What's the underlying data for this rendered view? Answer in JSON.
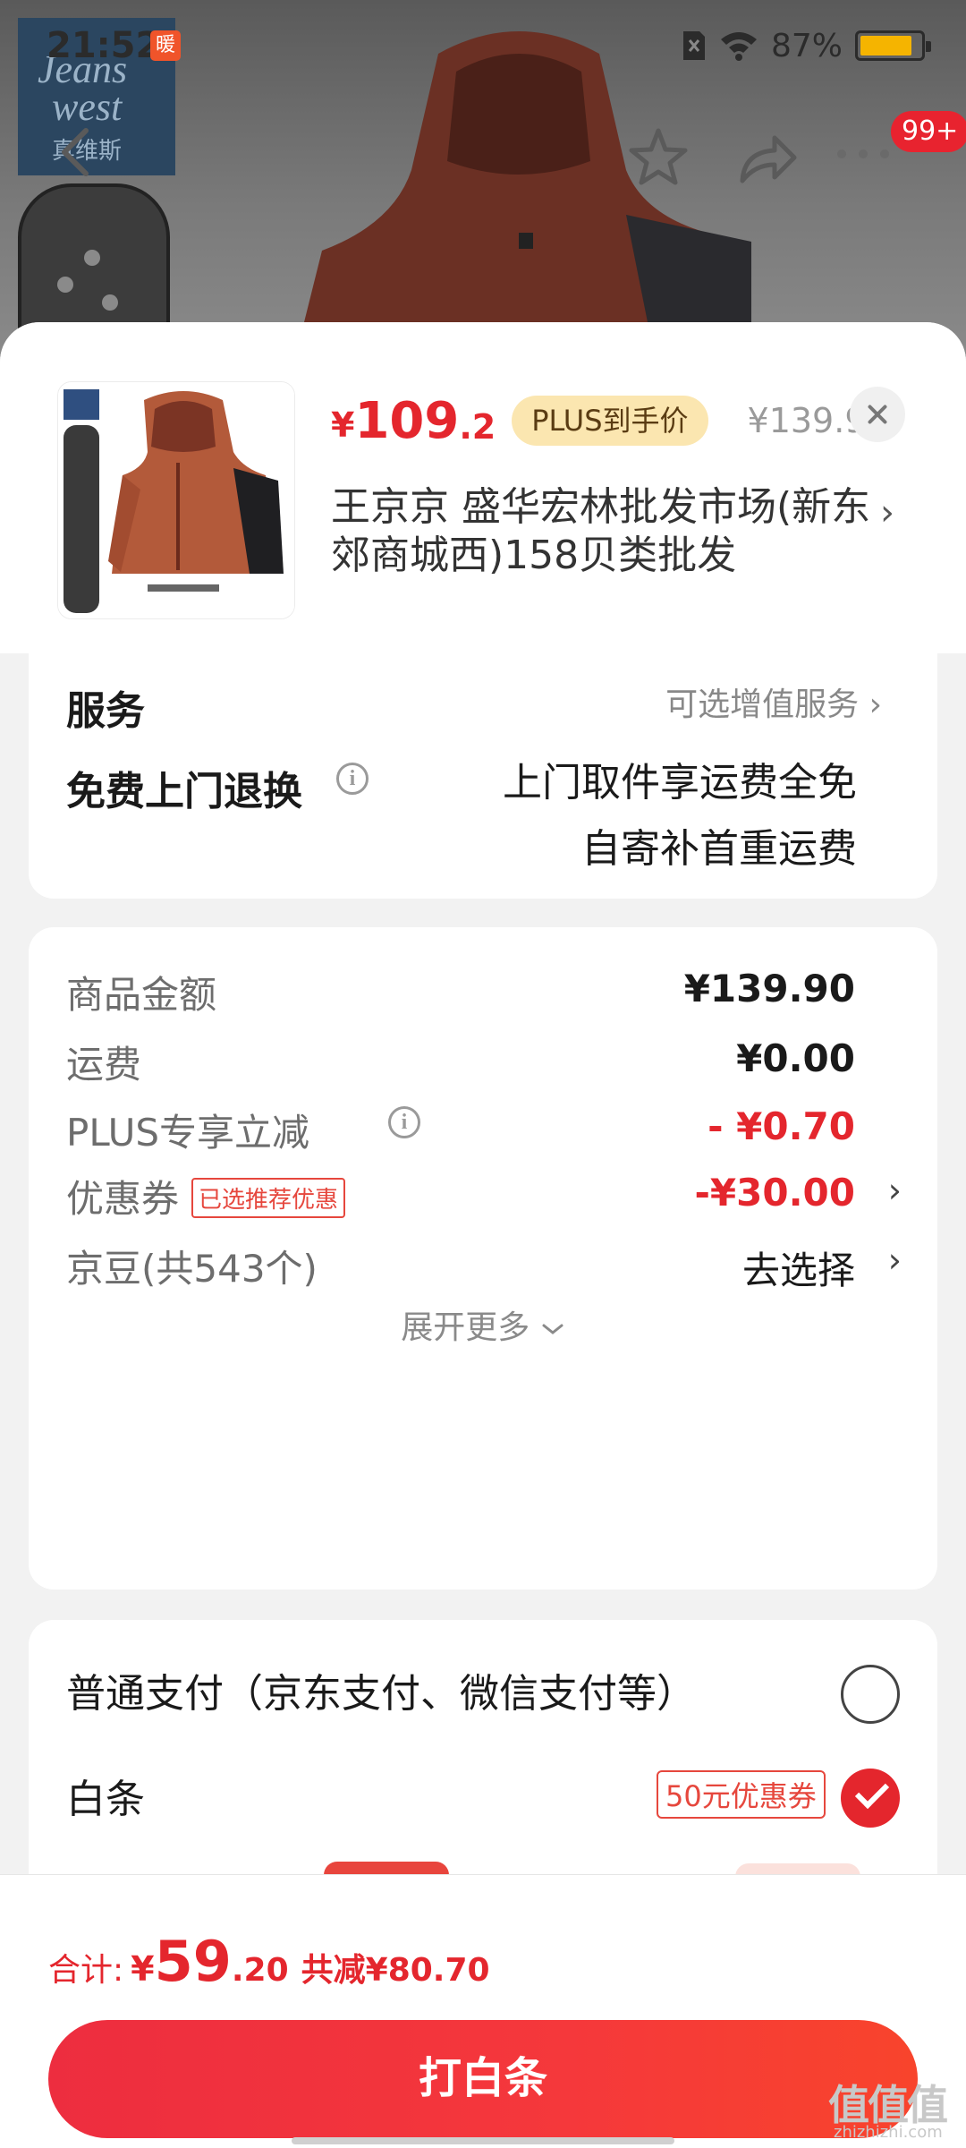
{
  "status_bar": {
    "time": "21:52",
    "badge": "暖",
    "battery_percent": "87%",
    "battery_level": 0.87
  },
  "product_page": {
    "brand_line1": "Jeans",
    "brand_line2": "west",
    "brand_cn": "真维斯",
    "cart_badge": "99+"
  },
  "sheet": {
    "price_symbol": "¥",
    "price_int": "109",
    "price_dec": ".2",
    "plus_badge": "PLUS到手价",
    "original_price": "¥139.9",
    "address": "王京京  盛华宏林批发市场(新东郊商城西)158贝类批发",
    "address_arrow": "›"
  },
  "service_card": {
    "cut_label": "服务",
    "cut_value": "可选增值服务 ›",
    "free_return_label": "免费上门退换",
    "free_return_line1": "上门取件享运费全免",
    "free_return_line2": "自寄补首重运费"
  },
  "price_card": {
    "rows": [
      {
        "label": "商品金额",
        "value": "¥139.90"
      },
      {
        "label": "运费",
        "value": "¥0.00"
      },
      {
        "label": "PLUS专享立减",
        "value": "- ¥0.70"
      },
      {
        "label": "优惠券",
        "tag": "已选推荐优惠",
        "value": "-¥30.00",
        "arrow": "›"
      },
      {
        "label": "京豆(共543个)",
        "value": "去选择",
        "arrow": "›"
      }
    ],
    "expand_more": "展开更多"
  },
  "payment_card": {
    "normal_pay_label": "普通支付（京东支付、微信支付等）",
    "baitiao_label": "白条",
    "baitiao_coupon": "50元优惠券"
  },
  "footer": {
    "total_label": "合计:",
    "total_symbol": "¥",
    "total_int": "59",
    "total_dec": ".20",
    "total_saved": "共减¥80.70",
    "pay_button": "打白条"
  },
  "watermark": {
    "text": "值值值",
    "sub": "zhizhizhi.com"
  },
  "colors": {
    "accent_red": "#e4262d",
    "plus_gold": "#fbe6b0",
    "battery": "#f5b400"
  }
}
